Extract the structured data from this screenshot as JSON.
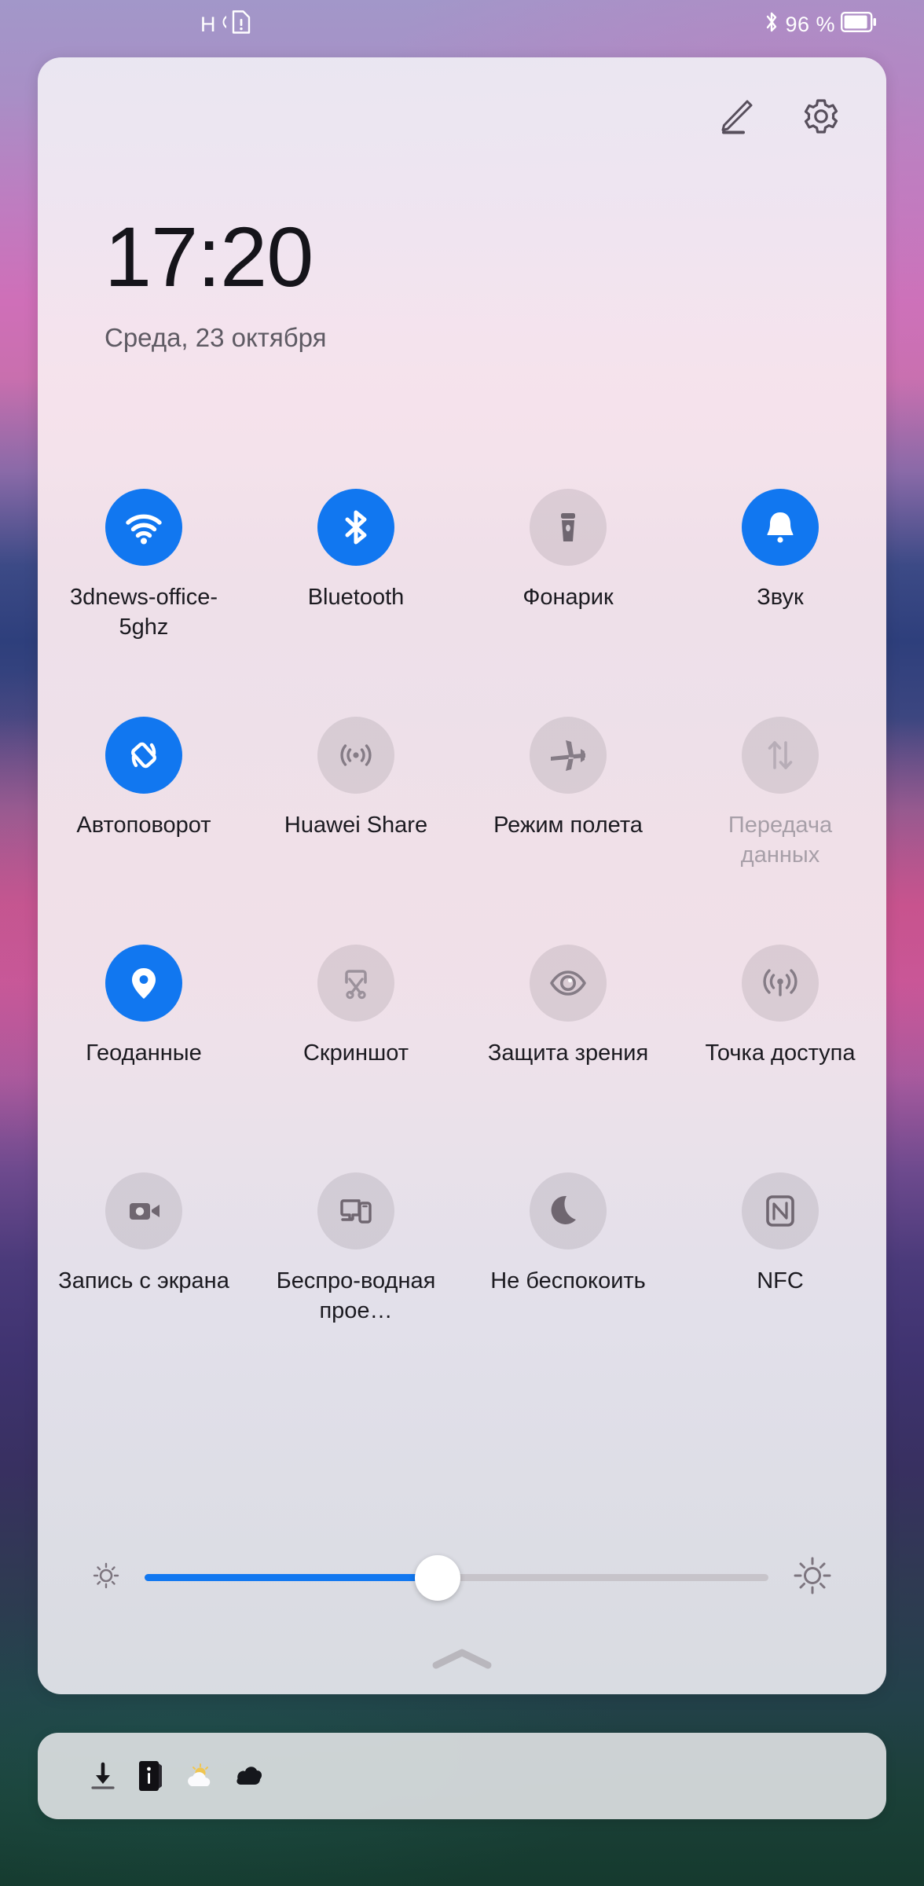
{
  "status_bar": {
    "network_type": "H",
    "sim_icon": "sim-card-alert-icon",
    "signal_icon": "signal-icon",
    "bluetooth_icon": "bluetooth-icon",
    "battery_percent": "96 %",
    "battery_icon": "battery-icon"
  },
  "panel": {
    "edit_icon": "pencil-edit-icon",
    "settings_icon": "gear-icon",
    "time": "17:20",
    "date": "Среда, 23 октября",
    "collapse_icon": "chevron-up-icon"
  },
  "toggles": [
    {
      "label": "3dnews-office-5ghz",
      "icon": "wifi-icon",
      "state": "on",
      "name": "toggle-wifi"
    },
    {
      "label": "Bluetooth",
      "icon": "bluetooth-icon",
      "state": "on",
      "name": "toggle-bluetooth"
    },
    {
      "label": "Фонарик",
      "icon": "flashlight-icon",
      "state": "off",
      "name": "toggle-flashlight"
    },
    {
      "label": "Звук",
      "icon": "bell-icon",
      "state": "on",
      "name": "toggle-sound"
    },
    {
      "label": "Автоповорот",
      "icon": "auto-rotate-icon",
      "state": "on",
      "name": "toggle-auto-rotate"
    },
    {
      "label": "Huawei Share",
      "icon": "huawei-share-icon",
      "state": "off",
      "name": "toggle-huawei-share"
    },
    {
      "label": "Режим полета",
      "icon": "airplane-icon",
      "state": "off",
      "name": "toggle-airplane-mode"
    },
    {
      "label": "Передача данных",
      "icon": "data-transfer-icon",
      "state": "disabled",
      "name": "toggle-mobile-data"
    },
    {
      "label": "Геоданные",
      "icon": "location-pin-icon",
      "state": "on",
      "name": "toggle-location"
    },
    {
      "label": "Скриншот",
      "icon": "scissors-icon",
      "state": "off",
      "name": "toggle-screenshot"
    },
    {
      "label": "Защита зрения",
      "icon": "eye-icon",
      "state": "off",
      "name": "toggle-eye-comfort"
    },
    {
      "label": "Точка доступа",
      "icon": "hotspot-icon",
      "state": "off",
      "name": "toggle-hotspot"
    },
    {
      "label": "Запись с экрана",
      "icon": "camcorder-icon",
      "state": "off",
      "name": "toggle-screen-record"
    },
    {
      "label": "Беспро-водная прое…",
      "icon": "cast-screen-icon",
      "state": "off",
      "name": "toggle-wireless-projection"
    },
    {
      "label": "Не беспокоить",
      "icon": "moon-icon",
      "state": "off",
      "name": "toggle-do-not-disturb"
    },
    {
      "label": "NFC",
      "icon": "nfc-icon",
      "state": "off",
      "name": "toggle-nfc"
    }
  ],
  "brightness": {
    "low_icon": "brightness-low-icon",
    "high_icon": "brightness-high-icon",
    "value_percent": 47
  },
  "notifications": {
    "icons": [
      "download-icon",
      "info-book-icon",
      "weather-sun-cloud-icon",
      "cloud-icon"
    ]
  },
  "colors": {
    "accent_blue": "#1177f0",
    "toggle_off_bg": "rgba(130,118,130,0.20)",
    "label_text": "#1b1a20",
    "label_disabled": "#a79fa8"
  }
}
